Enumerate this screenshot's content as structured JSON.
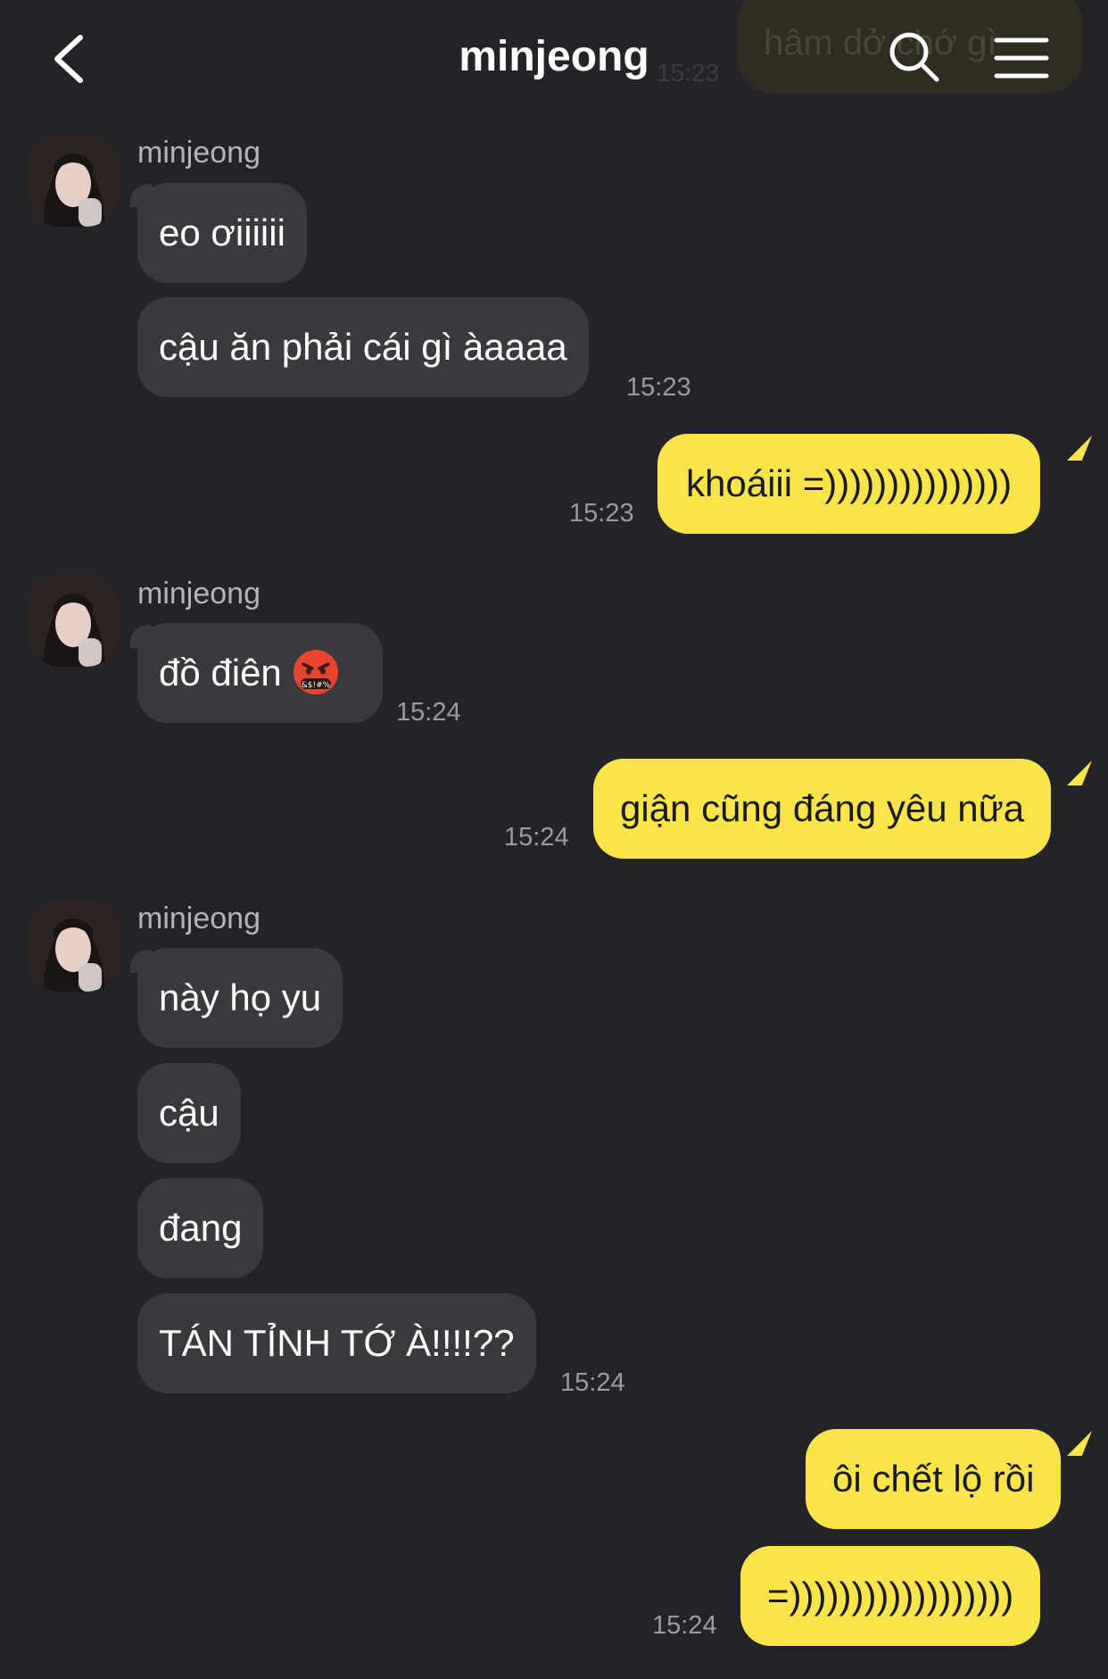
{
  "header": {
    "title": "minjeong"
  },
  "ghost": {
    "text": "hâm dở chớ gì",
    "time": "15:23"
  },
  "messages": [
    {
      "text": "eo ơiiiiii"
    },
    {
      "text": "cậu ăn phải cái gì àaaaa",
      "time": "15:23"
    },
    {
      "text": "khoáiii =)))))))))))))))",
      "time": "15:23"
    },
    {
      "text": "đồ điên",
      "emoji": "angry-cursing-face",
      "time": "15:24"
    },
    {
      "text": "giận cũng đáng yêu nữa",
      "time": "15:24"
    },
    {
      "text": "này họ yu"
    },
    {
      "text": "cậu"
    },
    {
      "text": "đang"
    },
    {
      "text": "TÁN TỈNH TỚ À!!!!??",
      "time": "15:24"
    },
    {
      "text": "ôi chết lộ rồi"
    },
    {
      "text": "=))))))))))))))))))",
      "time": "15:24"
    }
  ],
  "sender": {
    "name": "minjeong"
  },
  "colors": {
    "background": "#242428",
    "incoming": "#3a3a3e",
    "outgoing": "#f9e549"
  }
}
